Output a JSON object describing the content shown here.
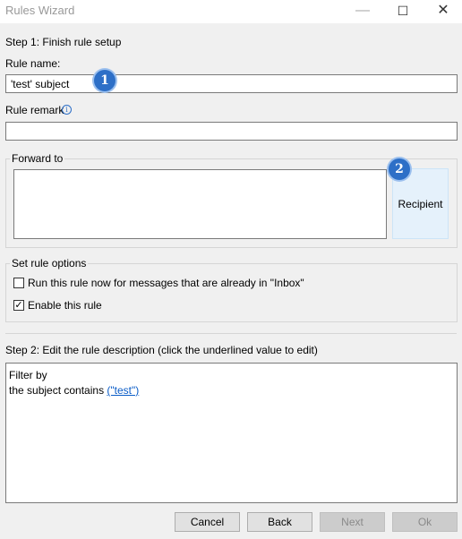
{
  "window": {
    "title": "Rules Wizard",
    "controls": {
      "minimize": "—",
      "maximize": "☐",
      "close": "✕"
    }
  },
  "step1": {
    "heading": "Step 1: Finish rule setup",
    "rule_name_label": "Rule name:",
    "rule_name_value": "'test' subject",
    "rule_remark_label": "Rule remark",
    "rule_remark_value": ""
  },
  "forward": {
    "legend": "Forward to",
    "recipient_button": "Recipient"
  },
  "options": {
    "legend": "Set rule options",
    "run_now": {
      "label": "Run this rule now for messages that are already in \"Inbox\"",
      "checked": false
    },
    "enable": {
      "label": "Enable this rule",
      "checked": true
    }
  },
  "step2": {
    "heading": "Step 2: Edit the rule description (click the underlined value to edit)",
    "line1": "Filter by",
    "line2_prefix": "the subject contains ",
    "line2_link": "(\"test\")"
  },
  "badges": {
    "one": "1",
    "two": "2"
  },
  "buttons": {
    "cancel": "Cancel",
    "back": "Back",
    "next": "Next",
    "ok": "Ok"
  },
  "colors": {
    "badge": "#2d6fc7",
    "link": "#0a5cc7",
    "recipient_bg": "#e5f1fb"
  }
}
